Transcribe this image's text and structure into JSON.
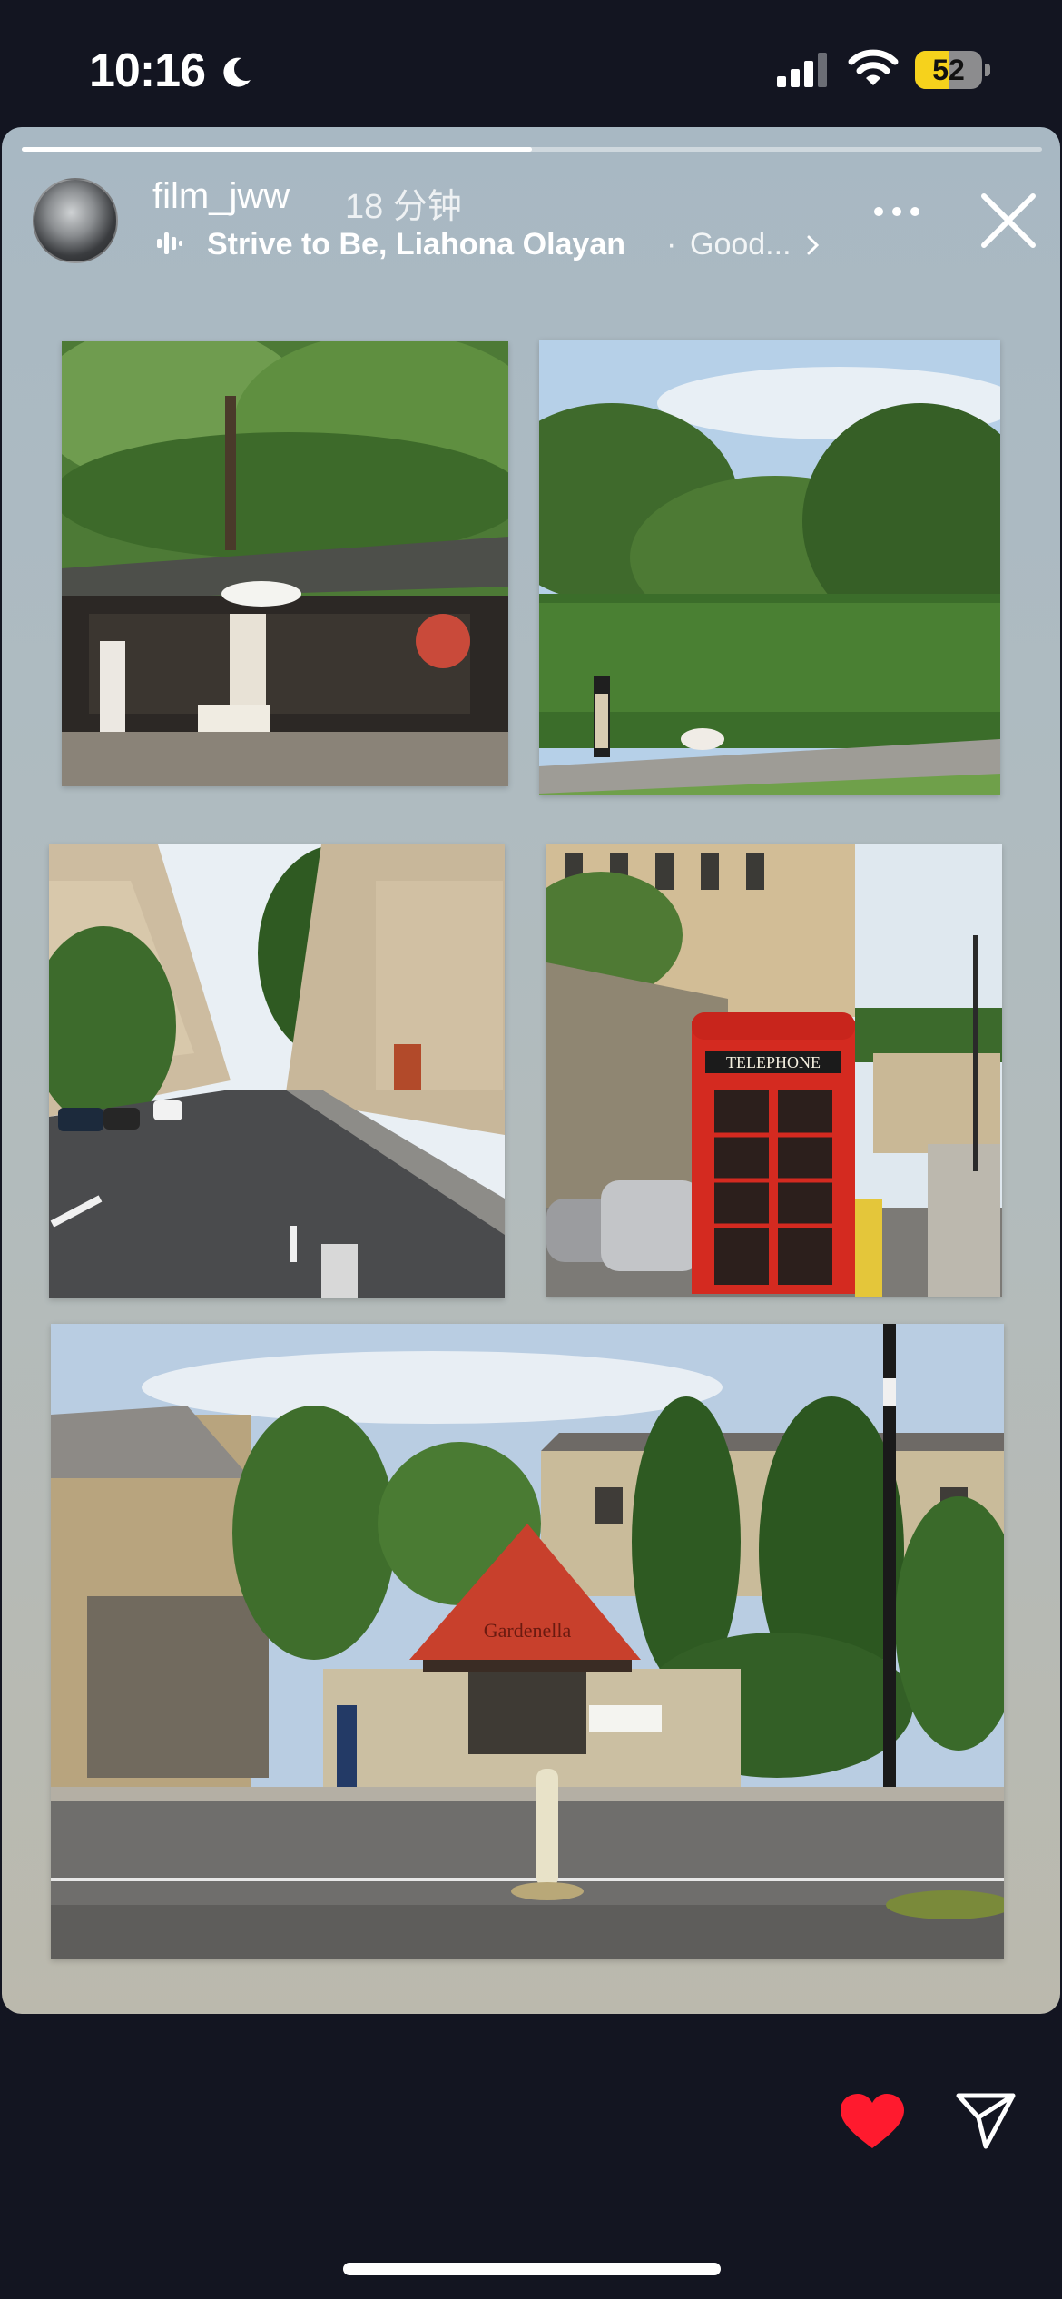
{
  "status_bar": {
    "time": "10:16",
    "battery_level": "52",
    "battery_fraction": 0.52,
    "battery_color": "#f6d21c"
  },
  "story": {
    "progress_fraction": 0.5,
    "username": "film_jww",
    "posted_ago": "18 分钟",
    "music": {
      "title": "Strive to Be, Liahona Olayan",
      "separator": "·",
      "album": "Good..."
    },
    "photos": [
      {
        "name": "photo-market-cafe"
      },
      {
        "name": "photo-park-walk"
      },
      {
        "name": "photo-city-street"
      },
      {
        "name": "photo-telephone-box"
      },
      {
        "name": "photo-garden-shop"
      }
    ],
    "signs": {
      "telephone": "TELEPHONE",
      "shop": "Gardenella"
    }
  },
  "actions": {
    "like_icon": "heart-icon",
    "like_color": "#ff1a2e",
    "share_icon": "send-icon"
  },
  "icons": {
    "status_moon": "moon-icon",
    "status_signal": "signal-icon",
    "status_wifi": "wifi-icon",
    "music": "music-bars-icon",
    "more": "more-icon",
    "close": "close-icon",
    "chevron": "chevron-right-icon"
  }
}
